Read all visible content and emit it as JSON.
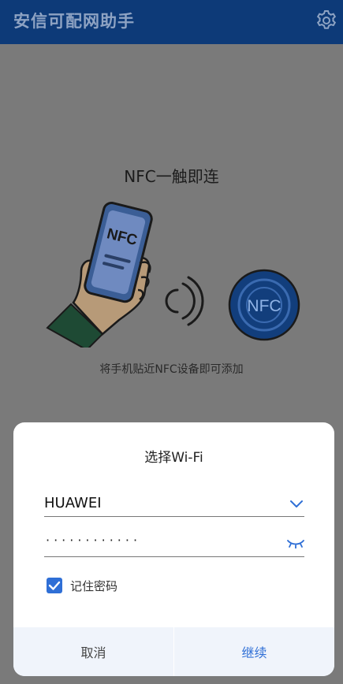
{
  "app_bar": {
    "title": "安信可配网助手",
    "settings_icon": "gear-icon"
  },
  "main": {
    "nfc_title": "NFC一触即连",
    "phone_label": "NFC",
    "tag_label": "NFC",
    "hint": "将手机贴近NFC设备即可添加"
  },
  "dialog": {
    "title": "选择Wi-Fi",
    "ssid_value": "HUAWEI",
    "password_masked": "············",
    "remember_label": "记住密码",
    "remember_checked": true,
    "cancel_label": "取消",
    "continue_label": "继续"
  },
  "colors": {
    "app_bar": "#0d3a78",
    "overlay_bg": "#7a7a7a",
    "accent": "#2f6fd6",
    "footer_bg": "#f0f4fb"
  }
}
